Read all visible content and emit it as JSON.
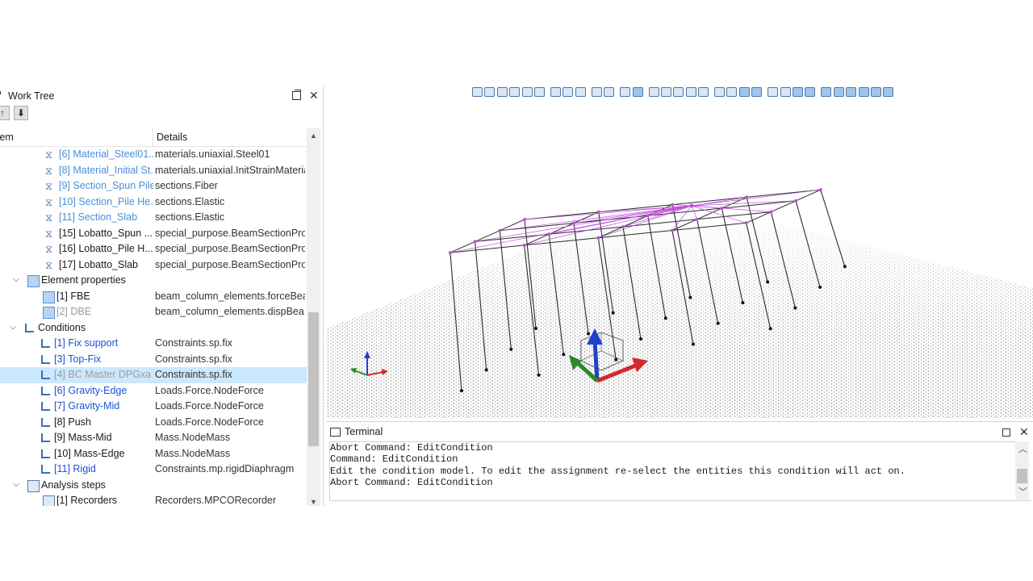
{
  "worktree": {
    "title": "Work Tree",
    "close_glyph": "✕",
    "up_glyph": "↑",
    "down_glyph": "⬇",
    "col_item": "tem",
    "col_details": "Details"
  },
  "tree_rows": [
    {
      "label": "[6] Material_Steel01...",
      "details": "materials.uniaxial.Steel01",
      "icon": "material-icon",
      "tone": "lightblue",
      "indent": 56
    },
    {
      "label": "[8] Material_Initial St...",
      "details": "materials.uniaxial.InitStrainMaterial",
      "icon": "material-icon",
      "tone": "lightblue",
      "indent": 56
    },
    {
      "label": "[9] Section_Spun Pile",
      "details": "sections.Fiber",
      "icon": "material-icon",
      "tone": "lightblue",
      "indent": 56
    },
    {
      "label": "[10] Section_Pile He...",
      "details": "sections.Elastic",
      "icon": "material-icon",
      "tone": "lightblue",
      "indent": 56
    },
    {
      "label": "[11] Section_Slab",
      "details": "sections.Elastic",
      "icon": "material-icon",
      "tone": "lightblue",
      "indent": 56
    },
    {
      "label": "[15] Lobatto_Spun ...",
      "details": "special_purpose.BeamSectionPro...",
      "icon": "material-icon",
      "tone": "dark",
      "indent": 56
    },
    {
      "label": "[16] Lobatto_Pile H...",
      "details": "special_purpose.BeamSectionPro...",
      "icon": "material-icon",
      "tone": "dark",
      "indent": 56
    },
    {
      "label": "[17] Lobatto_Slab",
      "details": "special_purpose.BeamSectionPro...",
      "icon": "material-icon",
      "tone": "dark",
      "indent": 56
    },
    {
      "label": "Element properties",
      "details": "",
      "icon": "element-properties-icon",
      "tone": "dark",
      "indent": 34,
      "chevron": "v"
    },
    {
      "label": "[1] FBE",
      "details": "beam_column_elements.forceBea...",
      "icon": "element-icon",
      "tone": "dark",
      "indent": 53
    },
    {
      "label": "[2] DBE",
      "details": "beam_column_elements.dispBea...",
      "icon": "element-icon",
      "tone": "gray",
      "indent": 53
    },
    {
      "label": "Conditions",
      "details": "",
      "icon": "conditions-icon",
      "tone": "dark",
      "indent": 30,
      "chevron": "v"
    },
    {
      "label": "[1] Fix support",
      "details": "Constraints.sp.fix",
      "icon": "condition-icon",
      "tone": "blue",
      "indent": 50
    },
    {
      "label": "[3] Top-Fix",
      "details": "Constraints.sp.fix",
      "icon": "condition-icon",
      "tone": "blue",
      "indent": 50
    },
    {
      "label": "[4] BC Master DPGxa",
      "details": "Constraints.sp.fix",
      "icon": "condition-icon",
      "tone": "gray",
      "indent": 50,
      "selected": true
    },
    {
      "label": "[6] Gravity-Edge",
      "details": "Loads.Force.NodeForce",
      "icon": "condition-icon",
      "tone": "blue",
      "indent": 50
    },
    {
      "label": "[7] Gravity-Mid",
      "details": "Loads.Force.NodeForce",
      "icon": "condition-icon",
      "tone": "blue",
      "indent": 50
    },
    {
      "label": "[8] Push",
      "details": "Loads.Force.NodeForce",
      "icon": "condition-icon",
      "tone": "dark",
      "indent": 50
    },
    {
      "label": "[9] Mass-Mid",
      "details": "Mass.NodeMass",
      "icon": "condition-icon",
      "tone": "dark",
      "indent": 50
    },
    {
      "label": "[10] Mass-Edge",
      "details": "Mass.NodeMass",
      "icon": "condition-icon",
      "tone": "dark",
      "indent": 50
    },
    {
      "label": "[11] Rigid",
      "details": "Constraints.mp.rigidDiaphragm",
      "icon": "condition-icon",
      "tone": "blue",
      "indent": 50
    },
    {
      "label": "Analysis steps",
      "details": "",
      "icon": "analysis-steps-icon",
      "tone": "dark",
      "indent": 34,
      "chevron": "v"
    },
    {
      "label": "[1] Recorders",
      "details": "Recorders.MPCORecorder",
      "icon": "recorder-icon",
      "tone": "dark",
      "indent": 53
    }
  ],
  "terminal": {
    "title": "Terminal",
    "close_glyph": "✕",
    "lines": [
      "Abort Command: EditCondition",
      "Command: EditCondition",
      "Edit the condition model. To edit the assignment re-select the entities this condition will act on.",
      "Abort Command: EditCondition"
    ]
  },
  "colors": {
    "frame_line": "#2b2b2b",
    "rigid_link": "#c04fd8",
    "axis_x": "#d42a2a",
    "axis_y": "#2a8a2a",
    "axis_z": "#1f3fcf",
    "selection": "#cce8ff"
  }
}
